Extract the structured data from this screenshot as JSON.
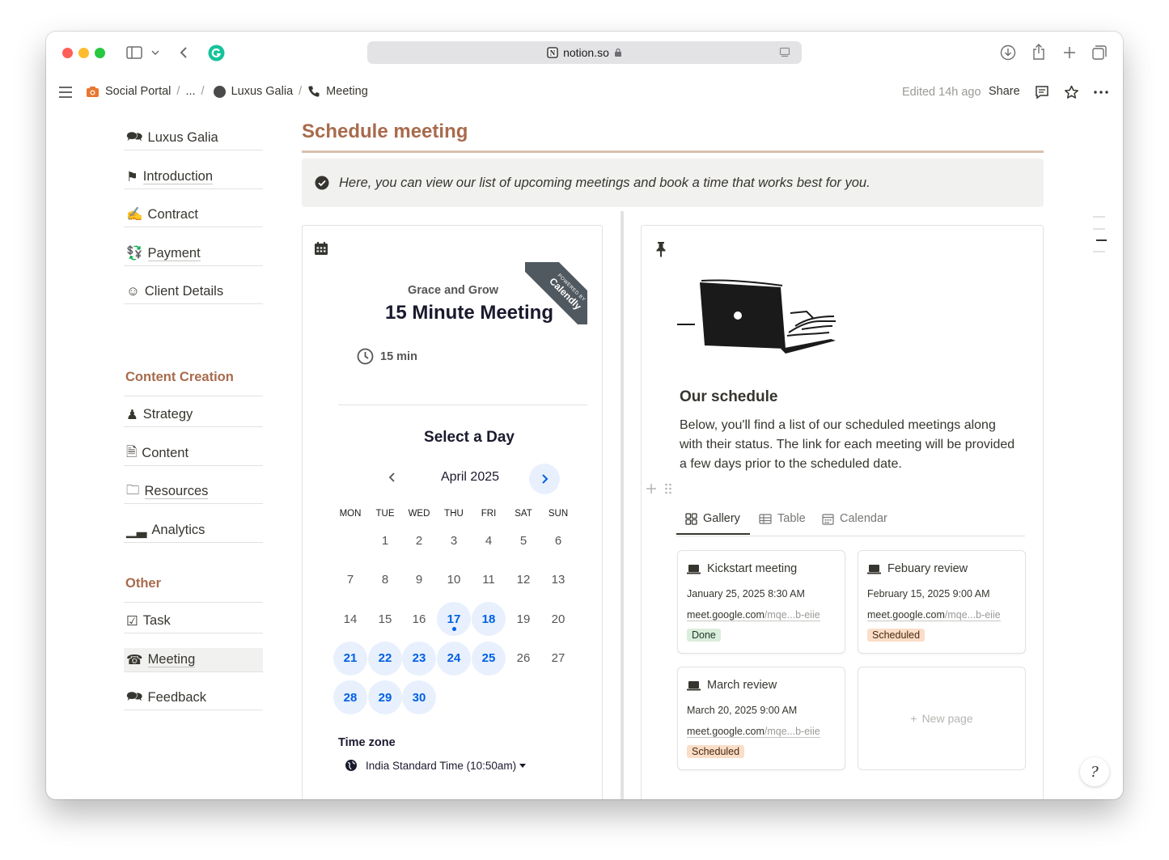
{
  "browser": {
    "url": "notion.so"
  },
  "breadcrumb": {
    "items": [
      "Social Portal",
      "...",
      "Luxus Galia",
      "Meeting"
    ],
    "edited": "Edited 14h ago",
    "share": "Share"
  },
  "sidebar": {
    "group1": [
      "Luxus Galia",
      "Introduction",
      "Contract",
      "Payment",
      "Client Details"
    ],
    "heading2": "Content Creation",
    "group2": [
      "Strategy",
      "Content",
      "Resources",
      "Analytics"
    ],
    "heading3": "Other",
    "group3": [
      "Task",
      "Meeting",
      "Feedback"
    ]
  },
  "page": {
    "title": "Schedule meeting",
    "callout": "Here, you can view our list of upcoming meetings and book a time that works best for you."
  },
  "calendly": {
    "organizer": "Grace and Grow",
    "event": "15 Minute Meeting",
    "duration": "15 min",
    "ribbon_small": "POWERED BY",
    "ribbon_big": "Calendly",
    "select_day": "Select a Day",
    "month": "April 2025",
    "weekdays": [
      "MON",
      "TUE",
      "WED",
      "THU",
      "FRI",
      "SAT",
      "SUN"
    ],
    "days": [
      [
        "",
        "1",
        "2",
        "3",
        "4",
        "5",
        "6"
      ],
      [
        "7",
        "8",
        "9",
        "10",
        "11",
        "12",
        "13"
      ],
      [
        "14",
        "15",
        "16",
        "17",
        "18",
        "19",
        "20"
      ],
      [
        "21",
        "22",
        "23",
        "24",
        "25",
        "26",
        "27"
      ],
      [
        "28",
        "29",
        "30",
        "",
        "",
        "",
        ""
      ]
    ],
    "available": [
      "17",
      "18",
      "21",
      "22",
      "23",
      "24",
      "25",
      "28",
      "29",
      "30"
    ],
    "today": "17",
    "timezone_label": "Time zone",
    "timezone": "India Standard Time (10:50am)",
    "accent": "#0060e6"
  },
  "schedule": {
    "heading": "Our schedule",
    "description": "Below, you'll find a list of our scheduled meetings along with their status. The link for each meeting will be provided a few days prior to the scheduled date.",
    "tabs": [
      "Gallery",
      "Table",
      "Calendar"
    ],
    "active_tab": "Gallery",
    "cards": [
      {
        "title": "Kickstart meeting",
        "date": "January 25, 2025 8:30 AM",
        "link_main": "meet.google.com",
        "link_dim": "/mqe...b-eiie",
        "status": "Done"
      },
      {
        "title": "Febuary review",
        "date": "February 15, 2025 9:00 AM",
        "link_main": "meet.google.com",
        "link_dim": "/mqe...b-eiie",
        "status": "Scheduled"
      },
      {
        "title": "March review",
        "date": "March 20, 2025 9:00 AM",
        "link_main": "meet.google.com",
        "link_dim": "/mqe...b-eiie",
        "status": "Scheduled"
      }
    ],
    "new_page": "New page",
    "status_colors": {
      "Done": "#dbeddb",
      "Scheduled": "#fadec9"
    }
  }
}
